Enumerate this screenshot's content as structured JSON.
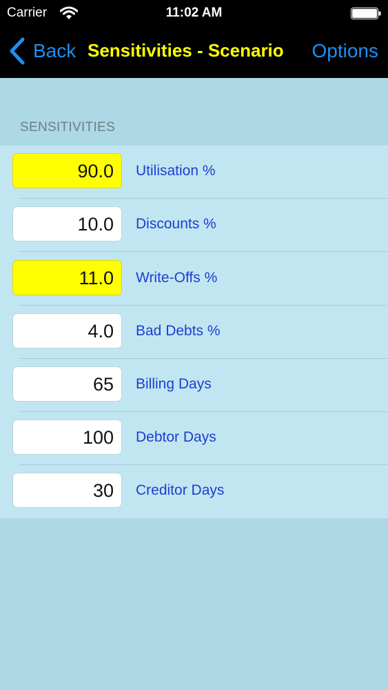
{
  "status_bar": {
    "carrier": "Carrier",
    "time": "11:02 AM"
  },
  "nav": {
    "back_label": "Back",
    "title": "Sensitivities - Scenario",
    "options_label": "Options"
  },
  "section": {
    "header": "SENSITIVITIES"
  },
  "rows": [
    {
      "value": "90.0",
      "label": "Utilisation %",
      "highlighted": true
    },
    {
      "value": "10.0",
      "label": "Discounts %",
      "highlighted": false
    },
    {
      "value": "11.0",
      "label": "Write-Offs %",
      "highlighted": true
    },
    {
      "value": "4.0",
      "label": "Bad Debts %",
      "highlighted": false
    },
    {
      "value": "65",
      "label": "Billing Days",
      "highlighted": false
    },
    {
      "value": "100",
      "label": "Debtor Days",
      "highlighted": false
    },
    {
      "value": "30",
      "label": "Creditor Days",
      "highlighted": false
    }
  ],
  "colors": {
    "accent": "#1e8ff0",
    "title": "#ffff00",
    "highlight": "#ffff00",
    "label": "#1b3fd0",
    "background": "#add8e6",
    "table": "#c2e6f1"
  }
}
